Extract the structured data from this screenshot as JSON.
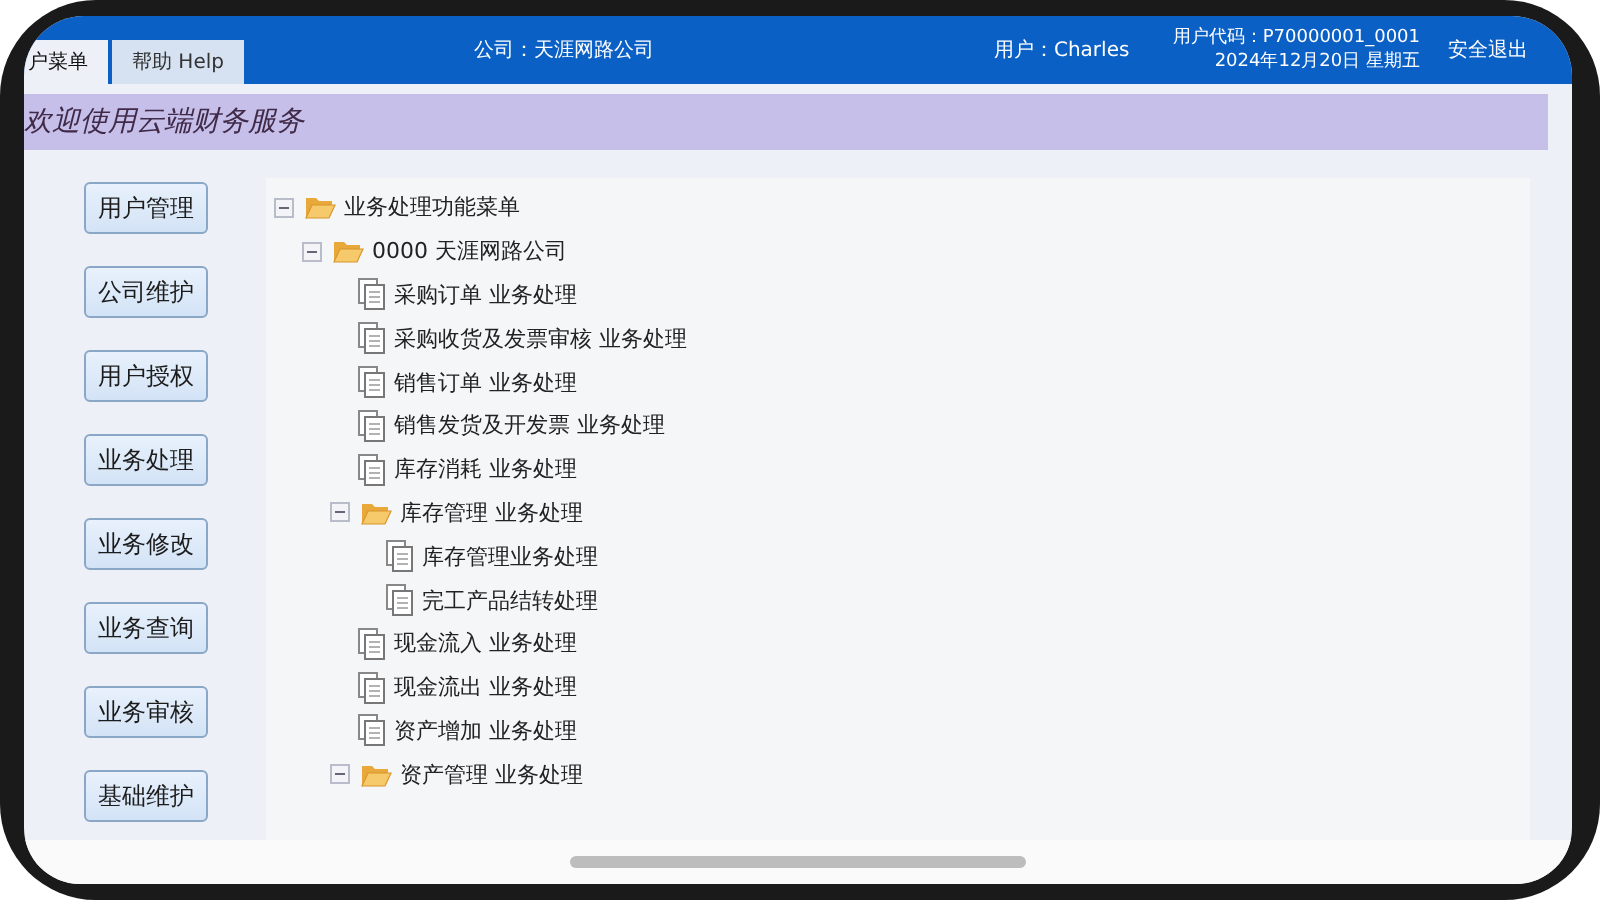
{
  "header": {
    "tabs": [
      {
        "label": "户菜单",
        "selected": true
      },
      {
        "label": "帮助 Help",
        "selected": false
      }
    ],
    "company": "公司：天涯网路公司",
    "user": "用户：Charles",
    "user_code": "用户代码：P70000001_0001",
    "date": "2024年12月20日 星期五",
    "logout": "安全退出"
  },
  "banner": "欢迎使用云端财务服务",
  "side_buttons": [
    "用户管理",
    "公司维护",
    "用户授权",
    "业务处理",
    "业务修改",
    "业务查询",
    "业务审核",
    "基础维护"
  ],
  "tree": [
    {
      "label": "业务处理功能菜单",
      "kind": "folder",
      "expanded": true,
      "children": [
        {
          "label": "0000 天涯网路公司",
          "kind": "folder",
          "expanded": true,
          "children": [
            {
              "label": "采购订单 业务处理",
              "kind": "document"
            },
            {
              "label": "采购收货及发票审核 业务处理",
              "kind": "document"
            },
            {
              "label": "销售订单 业务处理",
              "kind": "document"
            },
            {
              "label": "销售发货及开发票 业务处理",
              "kind": "document"
            },
            {
              "label": "库存消耗 业务处理",
              "kind": "document"
            },
            {
              "label": "库存管理 业务处理",
              "kind": "folder",
              "expanded": true,
              "children": [
                {
                  "label": "库存管理业务处理",
                  "kind": "document"
                },
                {
                  "label": "完工产品结转处理",
                  "kind": "document"
                }
              ]
            },
            {
              "label": "现金流入 业务处理",
              "kind": "document"
            },
            {
              "label": "现金流出 业务处理",
              "kind": "document"
            },
            {
              "label": "资产增加 业务处理",
              "kind": "document"
            },
            {
              "label": "资产管理 业务处理",
              "kind": "folder",
              "expanded": true
            }
          ]
        }
      ]
    }
  ]
}
